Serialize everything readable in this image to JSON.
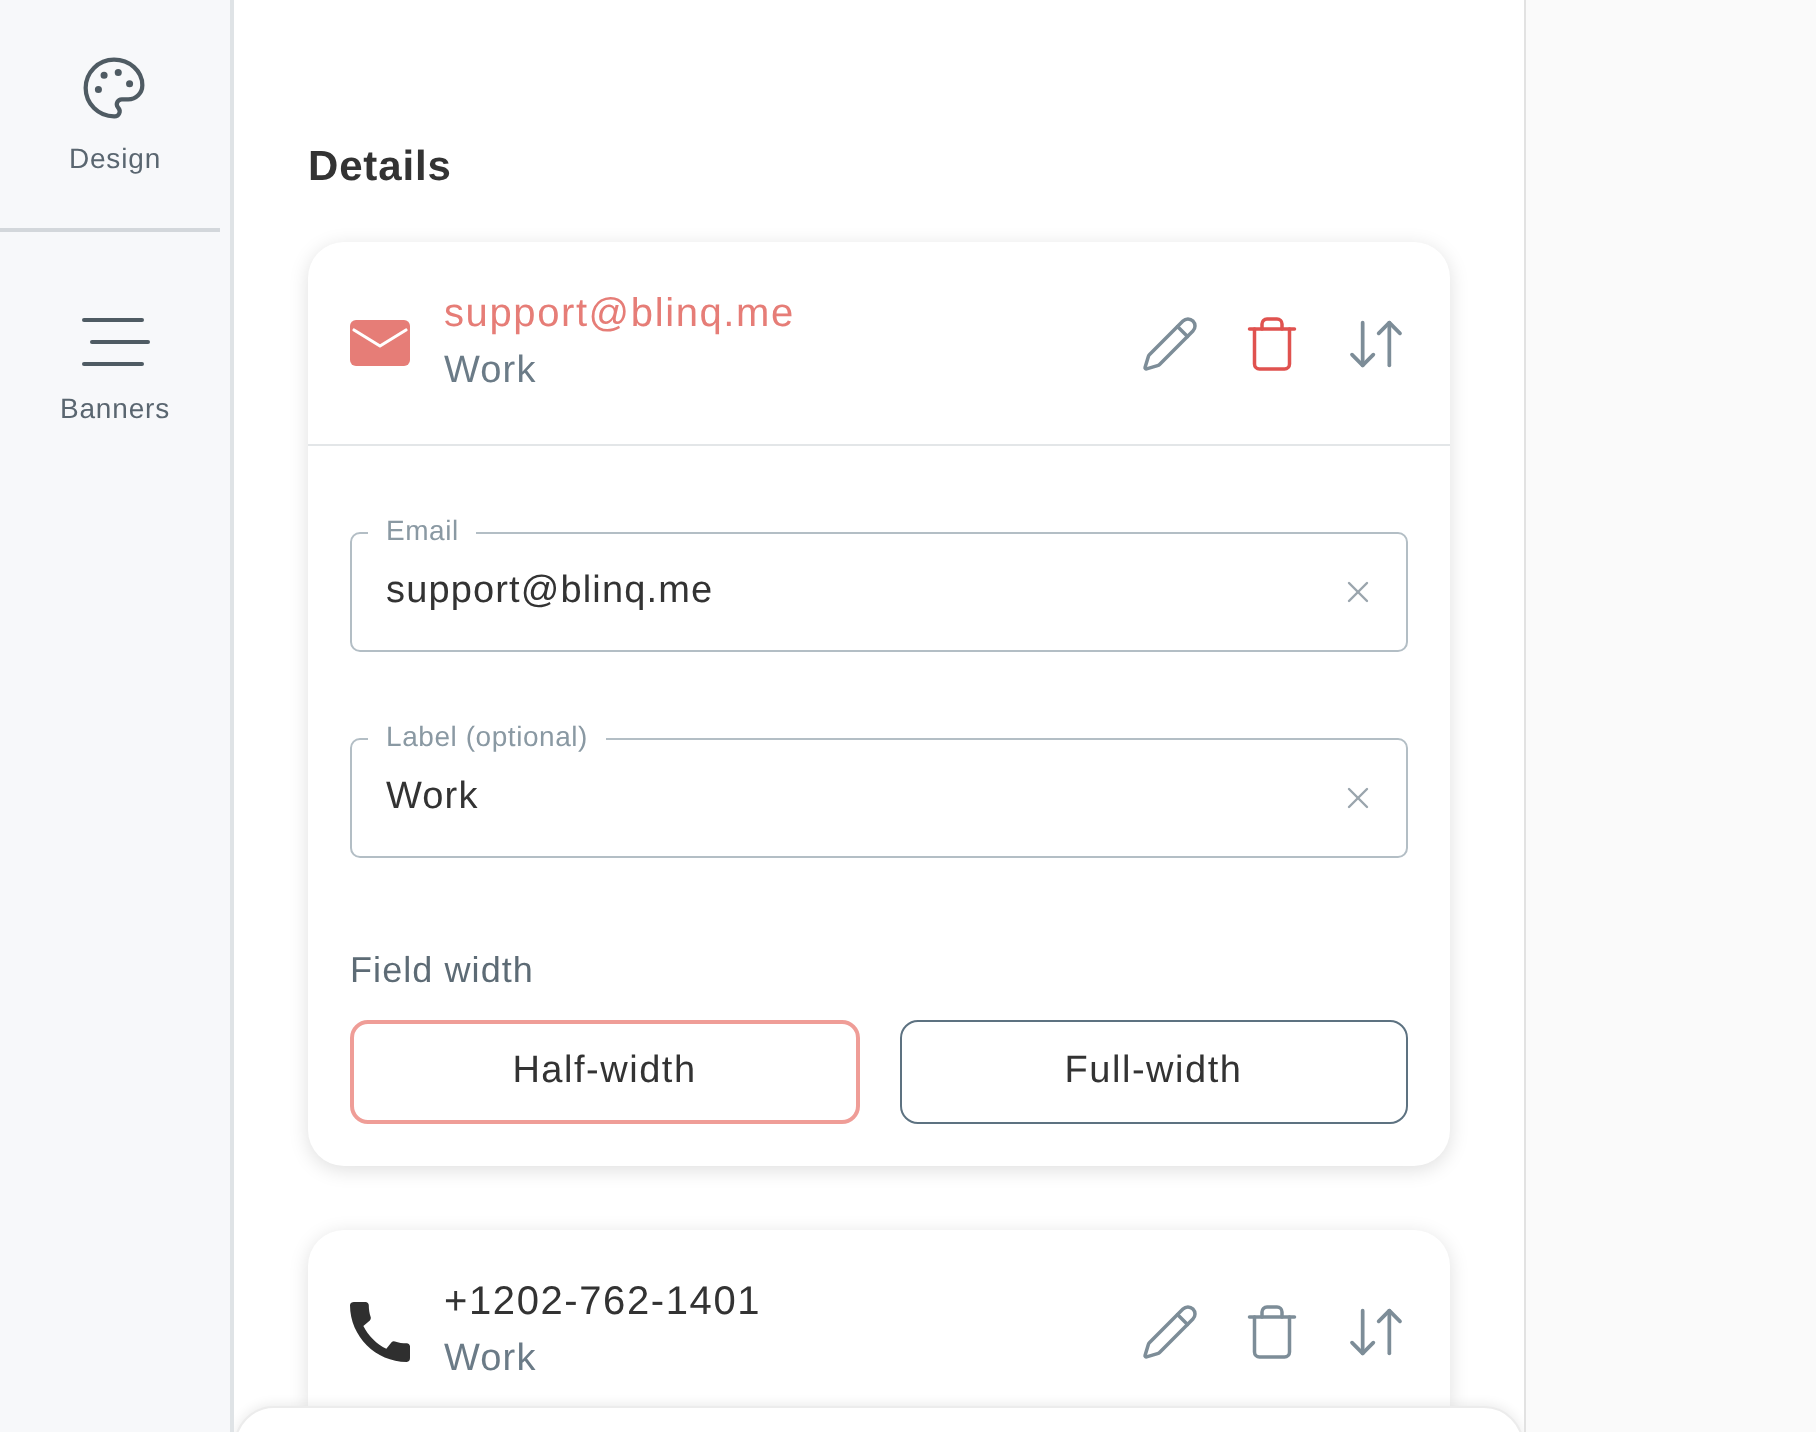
{
  "sidebar": {
    "items": [
      {
        "kind": "design",
        "label": "Design"
      },
      {
        "kind": "banners",
        "label": "Banners"
      }
    ]
  },
  "details": {
    "title": "Details",
    "items": [
      {
        "kind": "email",
        "value": "support@blinq.me",
        "label": "Work",
        "expanded": true,
        "editor": {
          "fields": [
            {
              "label": "Email",
              "value": "support@blinq.me"
            },
            {
              "label": "Label (optional)",
              "value": "Work"
            }
          ],
          "field_width": {
            "label": "Field width",
            "options": [
              {
                "label": "Half-width",
                "selected": true
              },
              {
                "label": "Full-width",
                "selected": false
              }
            ]
          }
        }
      },
      {
        "kind": "phone",
        "value": "+1202-762-1401",
        "label": "Work",
        "expanded": false
      }
    ]
  }
}
